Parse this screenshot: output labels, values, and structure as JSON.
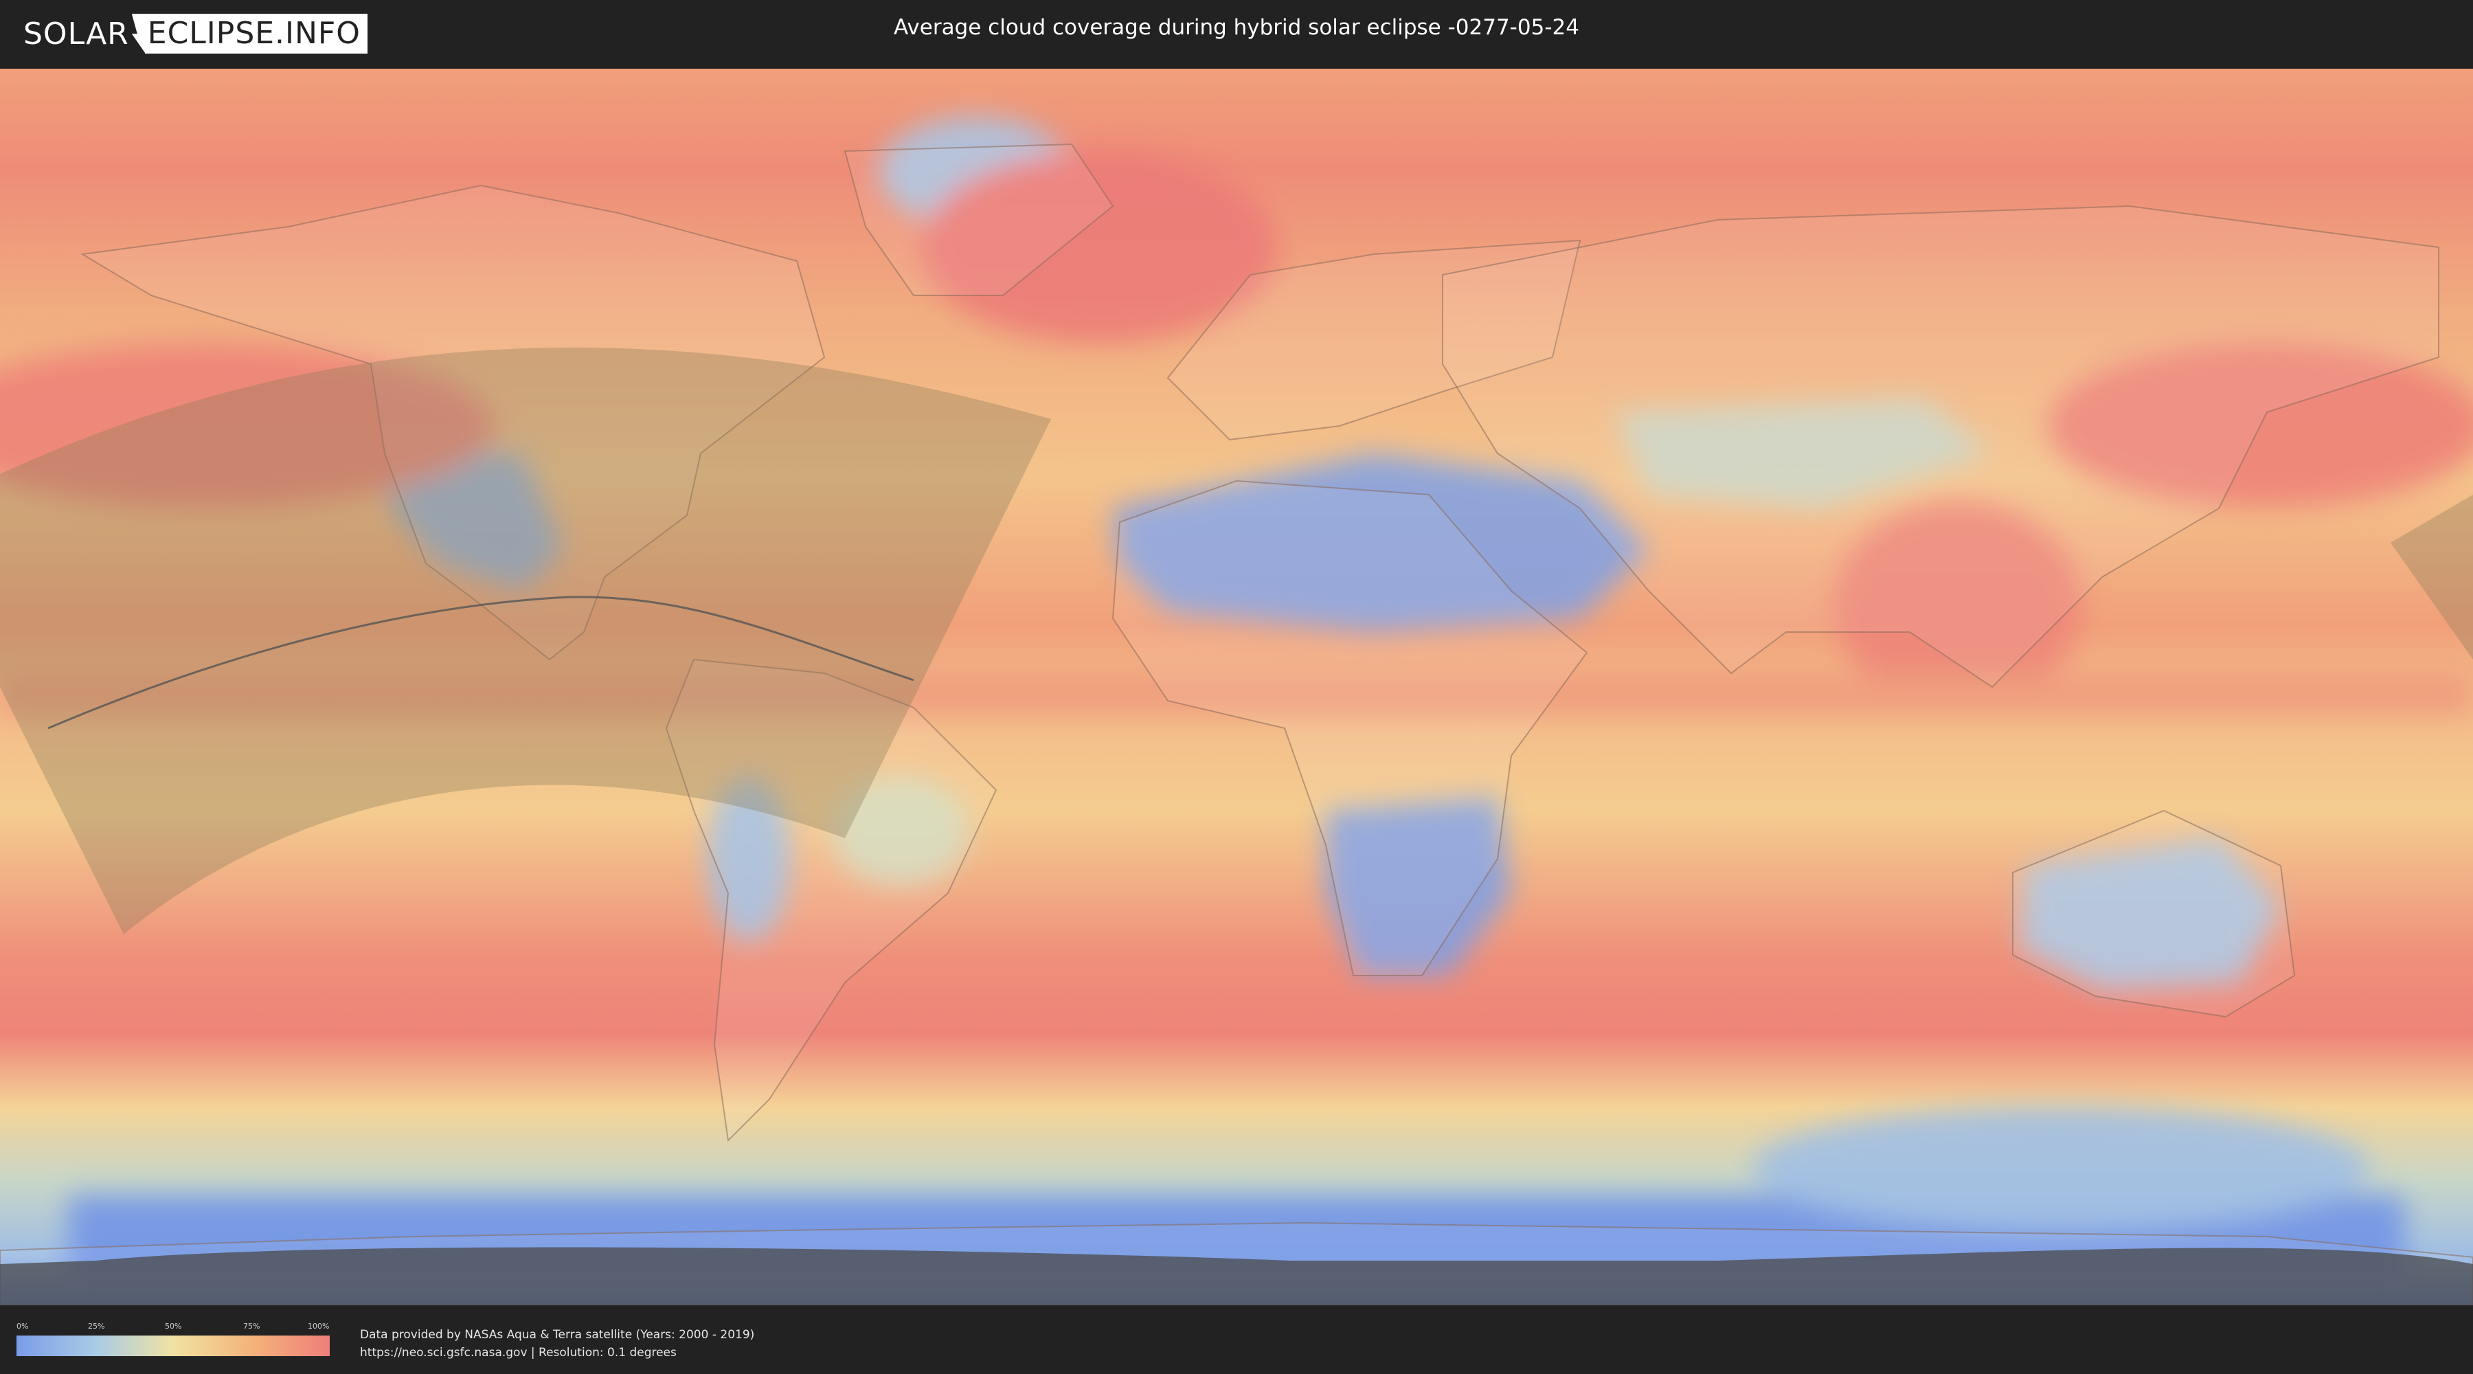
{
  "header": {
    "logo_left": "SOLAR",
    "logo_right": "ECLIPSE.INFO",
    "title": "Average cloud coverage during hybrid solar eclipse -0277-05-24"
  },
  "legend": {
    "ticks": [
      "0%",
      "25%",
      "50%",
      "75%",
      "100%"
    ],
    "colors": [
      "#7b9ce8",
      "#a8cbe6",
      "#f0e2a3",
      "#f4b37a",
      "#ee7f7a"
    ]
  },
  "footer": {
    "credit_line1": "Data provided by NASAs Aqua & Terra satellite (Years: 2000 - 2019)",
    "credit_line2": "https://neo.sci.gsfc.nasa.gov | Resolution: 0.1 degrees"
  },
  "map": {
    "projection": "equirectangular",
    "layer": "cloud-coverage",
    "eclipse_region_color": "#8a7a5a",
    "path_line_color": "#555555"
  }
}
